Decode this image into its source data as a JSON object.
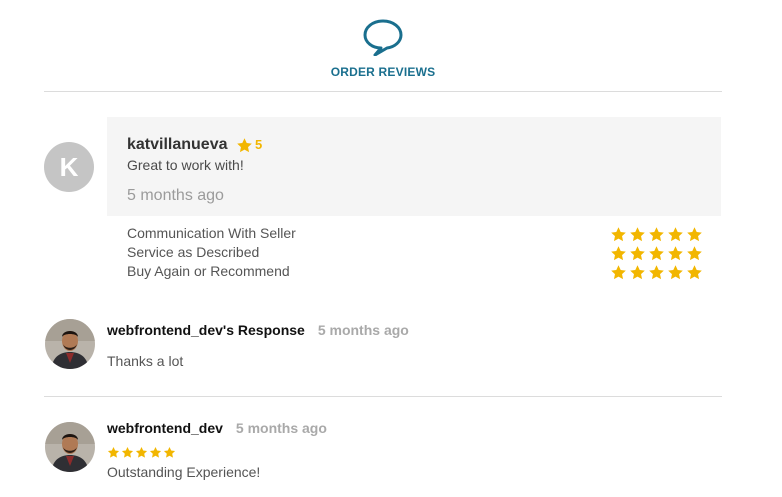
{
  "header": {
    "title": "ORDER REVIEWS",
    "icon": "speech-bubble-icon",
    "accent": "#1a6f8e"
  },
  "review": {
    "avatar_letter": "K",
    "reviewer": "katvillanueva",
    "rating": "5",
    "text": "Great to work with!",
    "time": "5 months ago",
    "categories": [
      {
        "label": "Communication With Seller",
        "stars": 5
      },
      {
        "label": "Service as Described",
        "stars": 5
      },
      {
        "label": "Buy Again or Recommend",
        "stars": 5
      }
    ]
  },
  "seller_response": {
    "name": "webfrontend_dev's Response",
    "time": "5 months ago",
    "text": "Thanks a lot"
  },
  "second_review": {
    "name": "webfrontend_dev",
    "time": "5 months ago",
    "stars": 5,
    "text": "Outstanding Experience!"
  },
  "colors": {
    "star": "#f2b600",
    "divider": "#dcdcdc",
    "box": "#f5f5f5"
  }
}
